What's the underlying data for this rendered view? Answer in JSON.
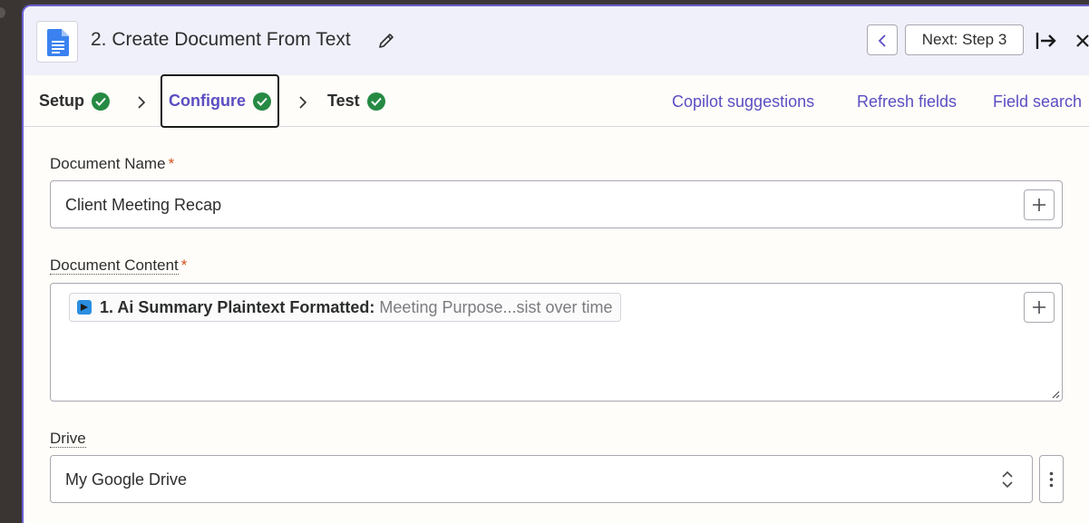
{
  "header": {
    "title": "2. Create Document From Text",
    "next_label": "Next: Step 3",
    "app_icon": "google-docs-icon"
  },
  "tabs": [
    {
      "label": "Setup",
      "status": "complete"
    },
    {
      "label": "Configure",
      "status": "complete",
      "active": true
    },
    {
      "label": "Test",
      "status": "complete"
    }
  ],
  "actions": {
    "copilot": "Copilot suggestions",
    "refresh": "Refresh fields",
    "search": "Field search"
  },
  "fields": {
    "document_name": {
      "label": "Document Name",
      "required": "*",
      "value": "Client Meeting Recap"
    },
    "document_content": {
      "label": "Document Content",
      "required": "*",
      "pill_label": "1. Ai Summary Plaintext Formatted:",
      "pill_value": "Meeting Purpose...sist over time"
    },
    "drive": {
      "label": "Drive",
      "value": "My Google Drive"
    }
  },
  "colors": {
    "accent": "#5a4ec2",
    "success": "#268a43",
    "required": "#d0521d",
    "header_bg": "#f0f0fb"
  }
}
